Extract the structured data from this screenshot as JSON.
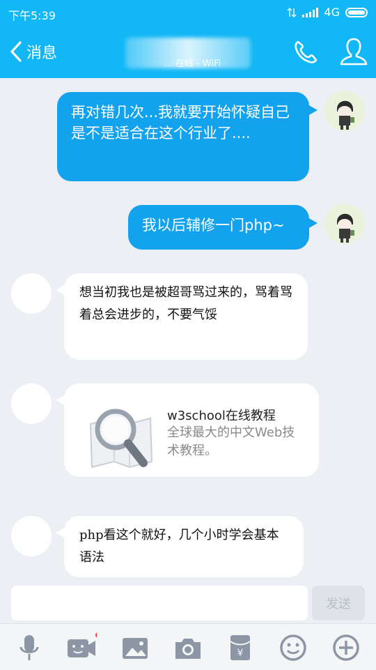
{
  "status_bar": {
    "time": "下午5:39",
    "network": "4G"
  },
  "header": {
    "back_label": "消息",
    "subtitle": "… 在线 - WiFi"
  },
  "messages": [
    {
      "from": "me",
      "text": "再对错几次...我就要开始怀疑自己是不是适合在这个行业了...."
    },
    {
      "from": "me",
      "text": "我以后辅修一门php~"
    },
    {
      "from": "them",
      "text": "想当初我也是被超哥骂过来的，骂着骂着总会进步的，不要气馁"
    },
    {
      "from": "them",
      "type": "link_card",
      "title": "w3school在线教程",
      "description": "全球最大的中文Web技术教程。"
    },
    {
      "from": "them",
      "text": "php看这个就好，几个小时学会基本语法"
    }
  ],
  "input": {
    "value": "",
    "placeholder": "",
    "send_label": "发送"
  },
  "toolbar": {
    "items": [
      "microphone-icon",
      "video-icon",
      "image-icon",
      "camera-icon",
      "red-packet-icon",
      "emoji-icon",
      "plus-icon"
    ],
    "badge_color": "#f53c3c"
  },
  "colors": {
    "accent": "#12b7f5",
    "bubble_out": "#13a2ee",
    "background": "#eceff3"
  }
}
